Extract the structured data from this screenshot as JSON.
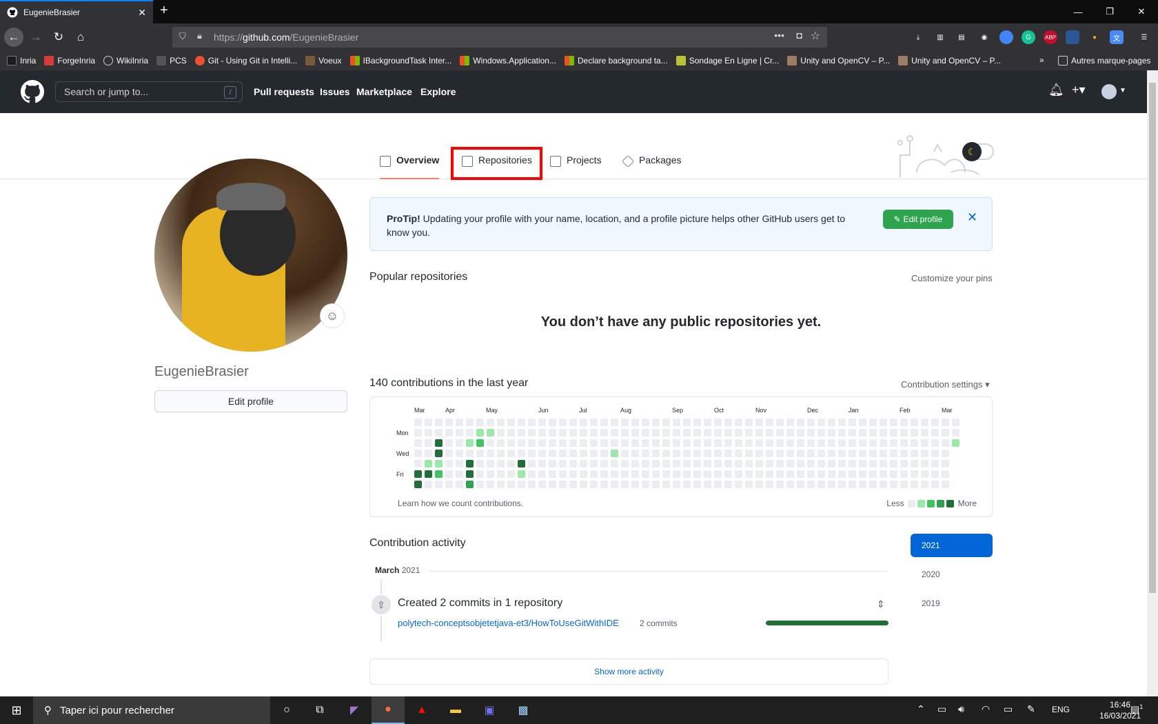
{
  "browser": {
    "tab_title": "EugenieBrasier",
    "url_proto": "https://",
    "url_host": "github.com",
    "url_path": "/EugenieBrasier",
    "bookmarks": [
      {
        "label": "Inria",
        "color": "#1b1b1b"
      },
      {
        "label": "ForgeInria",
        "color": "#d93a3a"
      },
      {
        "label": "WikiInria",
        "color": "#6d6d6d"
      },
      {
        "label": "PCS",
        "color": "#555555"
      },
      {
        "label": "Git - Using Git in Intelli...",
        "color": "#f05032"
      },
      {
        "label": "Voeux",
        "color": "#7a5a3a"
      },
      {
        "label": "IBackgroundTask Inter...",
        "color": "#f25022"
      },
      {
        "label": "Windows.Application...",
        "color": "#f25022"
      },
      {
        "label": "Declare background ta...",
        "color": "#f25022"
      },
      {
        "label": "Sondage En Ligne | Cr...",
        "color": "#b7c334"
      },
      {
        "label": "Unity and OpenCV – P...",
        "color": "#9b7d66"
      },
      {
        "label": "Unity and OpenCV – P...",
        "color": "#9b7d66"
      }
    ],
    "other_bookmarks": "Autres marque-pages"
  },
  "github": {
    "search_placeholder": "Search or jump to...",
    "search_shortcut": "/",
    "nav": [
      "Pull requests",
      "Issues",
      "Marketplace",
      "Explore"
    ]
  },
  "profile": {
    "tabs": [
      "Overview",
      "Repositories",
      "Projects",
      "Packages"
    ],
    "username": "EugenieBrasier",
    "edit_profile": "Edit profile",
    "protip_label": "ProTip!",
    "protip_text": " Updating your profile with your name, location, and a profile picture helps other GitHub users get to know you.",
    "protip_button": "Edit profile",
    "popular_title": "Popular repositories",
    "customize_pins": "Customize your pins",
    "no_repos": "You don’t have any public repositories yet.",
    "contrib_title": "140 contributions in the last year",
    "contrib_settings": "Contribution settings",
    "months": [
      "Mar",
      "Apr",
      "May",
      "Jun",
      "Jul",
      "Aug",
      "Sep",
      "Oct",
      "Nov",
      "Dec",
      "Jan",
      "Feb",
      "Mar"
    ],
    "days": [
      "Mon",
      "Wed",
      "Fri"
    ],
    "learn_how": "Learn how we count contributions.",
    "legend_less": "Less",
    "legend_more": "More",
    "contribution_levels": [
      {
        "week": 0,
        "day": 5,
        "level": 4
      },
      {
        "week": 0,
        "day": 6,
        "level": 4
      },
      {
        "week": 1,
        "day": 4,
        "level": 1
      },
      {
        "week": 1,
        "day": 5,
        "level": 4
      },
      {
        "week": 2,
        "day": 2,
        "level": 4
      },
      {
        "week": 2,
        "day": 3,
        "level": 4
      },
      {
        "week": 2,
        "day": 4,
        "level": 1
      },
      {
        "week": 2,
        "day": 5,
        "level": 2
      },
      {
        "week": 5,
        "day": 2,
        "level": 1
      },
      {
        "week": 5,
        "day": 4,
        "level": 4
      },
      {
        "week": 5,
        "day": 5,
        "level": 4
      },
      {
        "week": 5,
        "day": 6,
        "level": 3
      },
      {
        "week": 6,
        "day": 1,
        "level": 1
      },
      {
        "week": 6,
        "day": 2,
        "level": 2
      },
      {
        "week": 7,
        "day": 1,
        "level": 1
      },
      {
        "week": 10,
        "day": 4,
        "level": 4
      },
      {
        "week": 10,
        "day": 5,
        "level": 1
      },
      {
        "week": 19,
        "day": 3,
        "level": 1
      },
      {
        "week": 52,
        "day": 2,
        "level": 1
      }
    ],
    "activity_title": "Contribution activity",
    "years": [
      "2021",
      "2020",
      "2019"
    ],
    "month_label": "March",
    "month_year": "2021",
    "activity_summary": "Created 2 commits in 1 repository",
    "activity_repo": "polytech-conceptsobjetetjava-et3/HowToUseGitWithIDE",
    "activity_commits": "2 commits",
    "show_more": "Show more activity"
  },
  "taskbar": {
    "search_placeholder": "Taper ici pour rechercher",
    "lang": "ENG",
    "time": "16:46",
    "date": "16/03/2021",
    "notifications": "1"
  }
}
